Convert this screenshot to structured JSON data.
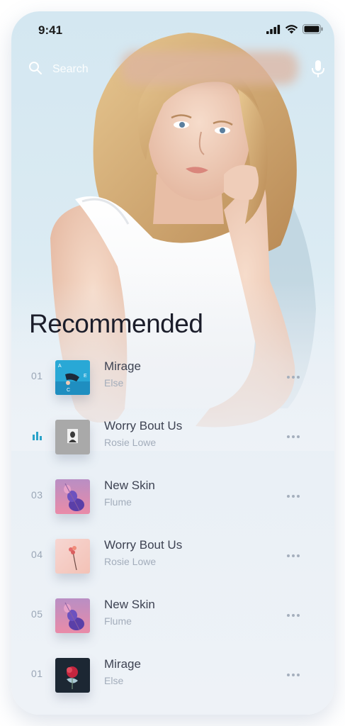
{
  "status_bar": {
    "time": "9:41"
  },
  "search": {
    "placeholder": "Search"
  },
  "section": {
    "heading": "Recommended"
  },
  "tracks": [
    {
      "number": "01",
      "title": "Mirage",
      "artist": "Else",
      "playing": false,
      "cover": "abstract-blue-cover"
    },
    {
      "number": "",
      "title": "Worry Bout Us",
      "artist": "Rosie Lowe",
      "playing": true,
      "cover": "gray-portrait-cover"
    },
    {
      "number": "03",
      "title": "New Skin",
      "artist": "Flume",
      "playing": false,
      "cover": "purple-flower-cover"
    },
    {
      "number": "04",
      "title": "Worry Bout Us",
      "artist": "Rosie Lowe",
      "playing": false,
      "cover": "pink-flower-cover"
    },
    {
      "number": "05",
      "title": "New Skin",
      "artist": "Flume",
      "playing": false,
      "cover": "purple-flower-cover"
    },
    {
      "number": "01",
      "title": "Mirage",
      "artist": "Else",
      "playing": false,
      "cover": "dark-red-flower-cover"
    }
  ],
  "colors": {
    "accent": "#2aa3c9",
    "heading": "#1b1d2a",
    "title": "#3d4252",
    "subtitle": "#a3adbb"
  }
}
